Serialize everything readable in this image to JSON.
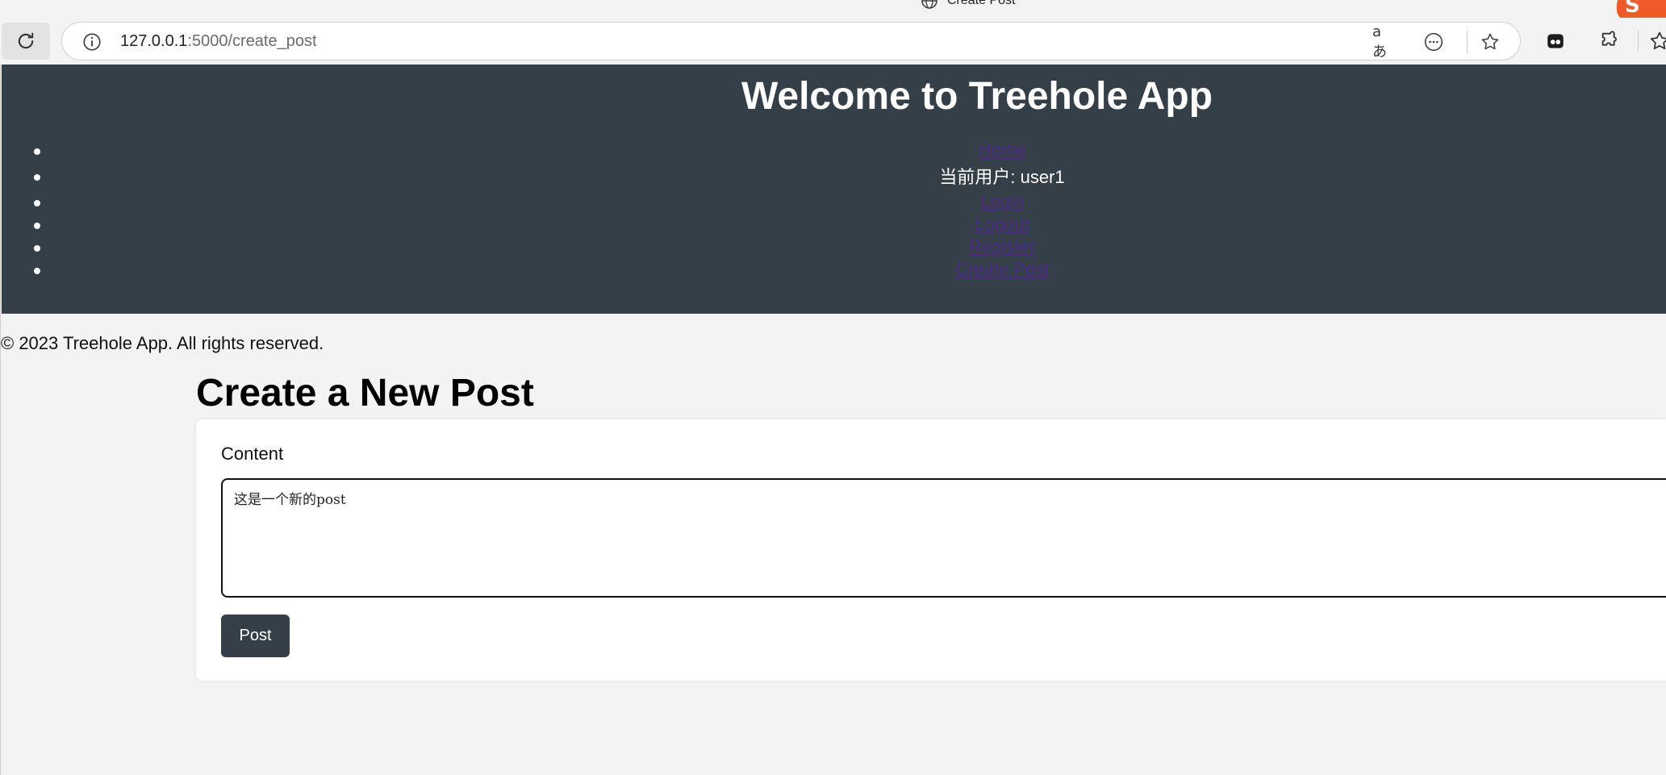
{
  "browser": {
    "tab_title": "Create Post",
    "url_host": "127.0.0.1",
    "url_path": ":5000/create_post",
    "read_aloud_label": "aあ",
    "icons": [
      "reload-icon",
      "info-icon",
      "read-aloud-icon",
      "more-icon",
      "favorite-star-icon",
      "extension-icon",
      "puzzle-icon",
      "favorites-icon"
    ]
  },
  "header": {
    "title": "Welcome to Treehole App",
    "nav": {
      "home": "Home",
      "current_user": "当前用户: user1",
      "login": "Login",
      "logout": "Logout",
      "register": "Register",
      "create_post": "Create Post"
    }
  },
  "footer": {
    "copyright": "© 2023 Treehole App. All rights reserved."
  },
  "main": {
    "page_title": "Create a New Post",
    "form": {
      "content_label": "Content",
      "content_value": "这是一个新的post",
      "submit_label": "Post"
    }
  },
  "colors": {
    "header_bg": "#343f48",
    "link": "#4b2a86",
    "page_bg": "#f3f3f3",
    "button_bg": "#343f48"
  }
}
